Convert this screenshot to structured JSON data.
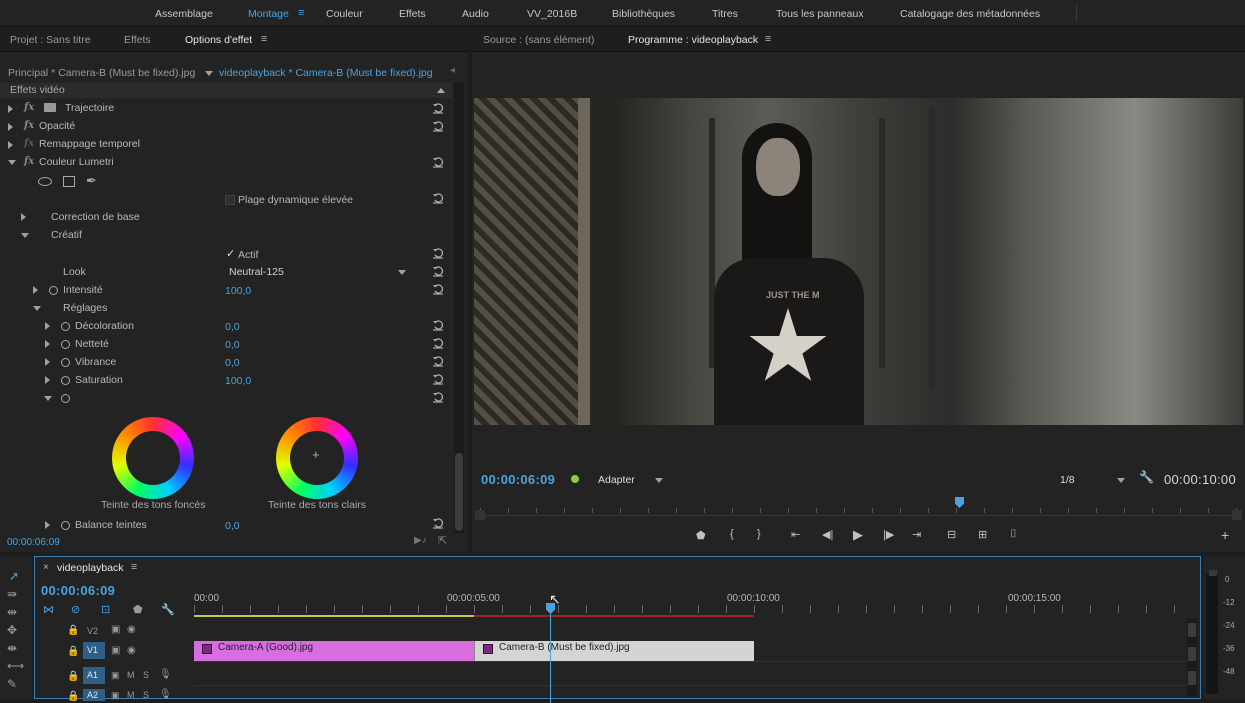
{
  "workspaces": [
    "Assemblage",
    "Montage",
    "Couleur",
    "Effets",
    "Audio",
    "VV_2016B",
    "Bibliothèques",
    "Titres",
    "Tous les panneaux",
    "Catalogage des métadonnées"
  ],
  "active_workspace": "Montage",
  "left_tabs": {
    "project": "Projet : Sans titre",
    "effects": "Effets",
    "effect_controls": "Options d'effet"
  },
  "effect_controls": {
    "master_clip": "Principal * Camera-B (Must be fixed).jpg",
    "sequence_clip": "videoplayback * Camera-B (Must be fixed).jpg",
    "section": "Effets vidéo",
    "effects": [
      "Trajectoire",
      "Opacité",
      "Remappage temporel",
      "Couleur Lumetri"
    ],
    "hdr_label": "Plage dynamique élevée",
    "basic_correction": "Correction de base",
    "creative": "Créatif",
    "actif": "Actif",
    "look_label": "Look",
    "look_value": "Neutral-125",
    "intensity_label": "Intensité",
    "intensity_value": "100,0",
    "adjustments": "Réglages",
    "params": [
      {
        "label": "Décoloration",
        "value": "0,0"
      },
      {
        "label": "Netteté",
        "value": "0,0"
      },
      {
        "label": "Vibrance",
        "value": "0,0"
      },
      {
        "label": "Saturation",
        "value": "100,0"
      }
    ],
    "shadow_tint": "Teinte des tons foncés",
    "highlight_tint": "Teinte des tons clairs",
    "tint_balance_label": "Balance teintes",
    "tint_balance_value": "0,0",
    "timecode": "00:00:06:09"
  },
  "monitor": {
    "source_tab": "Source : (sans élément)",
    "program_tab": "Programme : videoplayback",
    "timecode": "00:00:06:09",
    "fit": "Adapter",
    "resolution": "1/8",
    "duration": "00:00:10:00",
    "shirt_text": "JUST THE M"
  },
  "timeline": {
    "sequence_name": "videoplayback",
    "timecode": "00:00:06:09",
    "ruler": [
      "00:00",
      "00:00:05:00",
      "00:00:10:00",
      "00:00:15:00"
    ],
    "tracks": [
      "V2",
      "V1",
      "A1",
      "A2"
    ],
    "clips": [
      {
        "name": "Camera-A (Good).jpg",
        "color": "#d86de0"
      },
      {
        "name": "Camera-B (Must be fixed).jpg",
        "color": "#d4d4d4"
      }
    ],
    "meter_labels": [
      "0",
      "-12",
      "-24",
      "-36",
      "-48"
    ]
  },
  "colors": {
    "accent": "#4aa3e0",
    "bg": "#232323",
    "clip_a": "#d86de0",
    "clip_b": "#d4d4d4",
    "playhead": "#4aa3e0",
    "render_bar_red": "#a02020",
    "render_bar_yellow": "#c8c850"
  }
}
